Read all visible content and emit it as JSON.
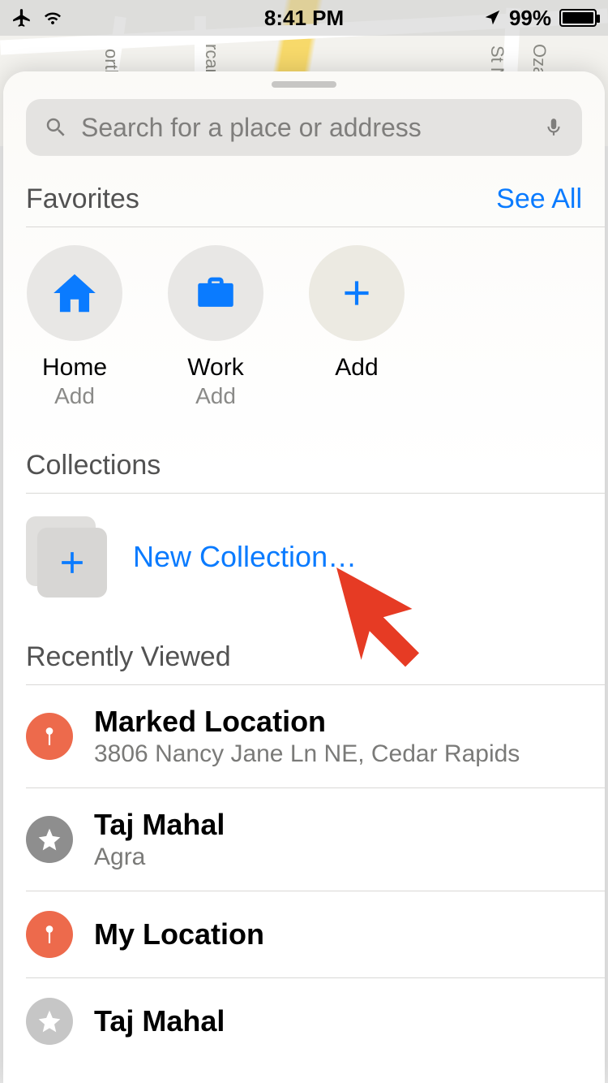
{
  "status": {
    "time": "8:41 PM",
    "battery_pct": "99%"
  },
  "map_labels": {
    "l1": "orthw",
    "l2": "rcard",
    "l3": "St NE",
    "l4": "Ozark"
  },
  "search": {
    "placeholder": "Search for a place or address"
  },
  "favorites": {
    "title": "Favorites",
    "see_all": "See All",
    "items": [
      {
        "label": "Home",
        "sub": "Add",
        "icon": "home"
      },
      {
        "label": "Work",
        "sub": "Add",
        "icon": "briefcase"
      },
      {
        "label": "Add",
        "sub": "",
        "icon": "plus"
      }
    ]
  },
  "collections": {
    "title": "Collections",
    "new_label": "New Collection…"
  },
  "recent": {
    "title": "Recently Viewed",
    "items": [
      {
        "title": "Marked Location",
        "subtitle": "3806 Nancy Jane Ln NE, Cedar Rapids",
        "icon": "pin-orange"
      },
      {
        "title": "Taj Mahal",
        "subtitle": "Agra",
        "icon": "star-gray"
      },
      {
        "title": "My Location",
        "subtitle": "",
        "icon": "pin-orange"
      },
      {
        "title": "Taj Mahal",
        "subtitle": "",
        "icon": "star-gray"
      }
    ]
  },
  "colors": {
    "accent": "#0a7bff",
    "orange": "#ed6a4c"
  }
}
